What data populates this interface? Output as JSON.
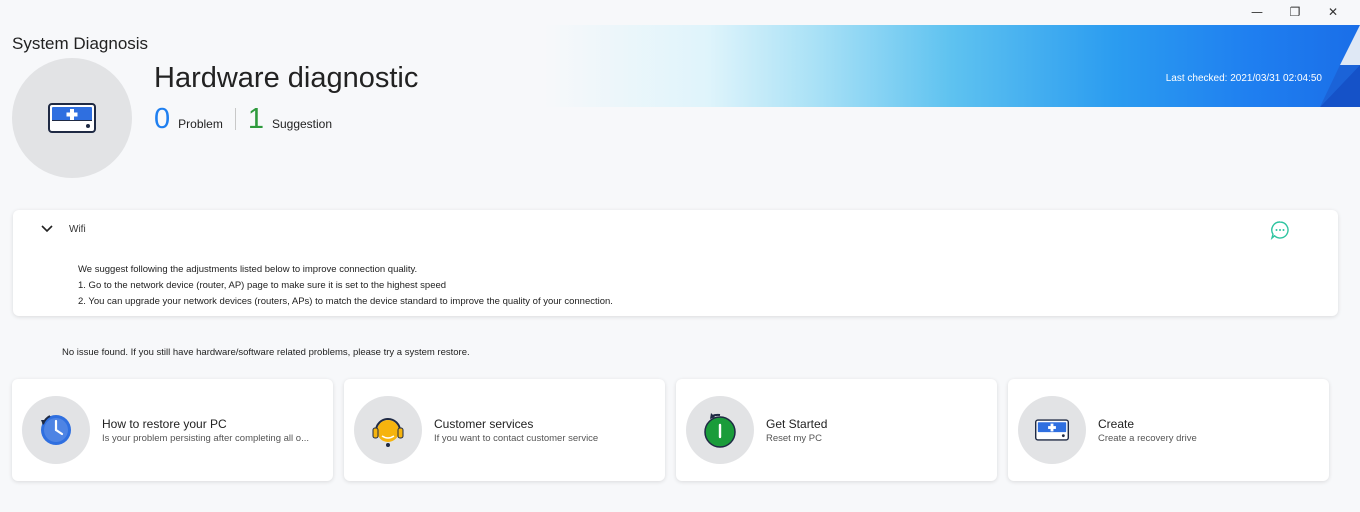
{
  "window": {
    "minimize_glyph": "—",
    "restore_glyph": "❐",
    "close_glyph": "✕"
  },
  "app": {
    "title": "System Diagnosis"
  },
  "hero": {
    "icon": "hard-drive-plus-icon",
    "title": "Hardware diagnostic",
    "problem_count": "0",
    "problem_label": "Problem",
    "suggestion_count": "1",
    "suggestion_label": "Suggestion",
    "last_checked": "Last checked: 2021/03/31 02:04:50"
  },
  "colors": {
    "accent_blue": "#1f7ff0",
    "suggestion_green": "#2e9a3c",
    "chat_icon": "#2ec4a0"
  },
  "wifi": {
    "label": "Wifi",
    "expand_icon": "chevron-down-icon",
    "chat_icon": "chat-bubble-icon",
    "lines": [
      "We suggest following the adjustments listed below to improve connection quality.",
      "1. Go to the network device (router, AP) page to make sure it is set to the highest speed",
      "2. You can upgrade your network devices (routers, APs) to match the device standard to improve the quality of your connection."
    ]
  },
  "no_issue_text": "No issue found. If you still have hardware/software related problems, please try a system restore.",
  "cards": [
    {
      "icon": "clock-restore-icon",
      "title": "How to restore your PC",
      "subtitle": "Is your problem persisting after completing all o..."
    },
    {
      "icon": "headset-support-icon",
      "title": "Customer services",
      "subtitle": "If you want to contact customer service"
    },
    {
      "icon": "power-reset-icon",
      "title": "Get Started",
      "subtitle": "Reset my PC"
    },
    {
      "icon": "recovery-drive-icon",
      "title": "Create",
      "subtitle": "Create a recovery drive"
    }
  ]
}
